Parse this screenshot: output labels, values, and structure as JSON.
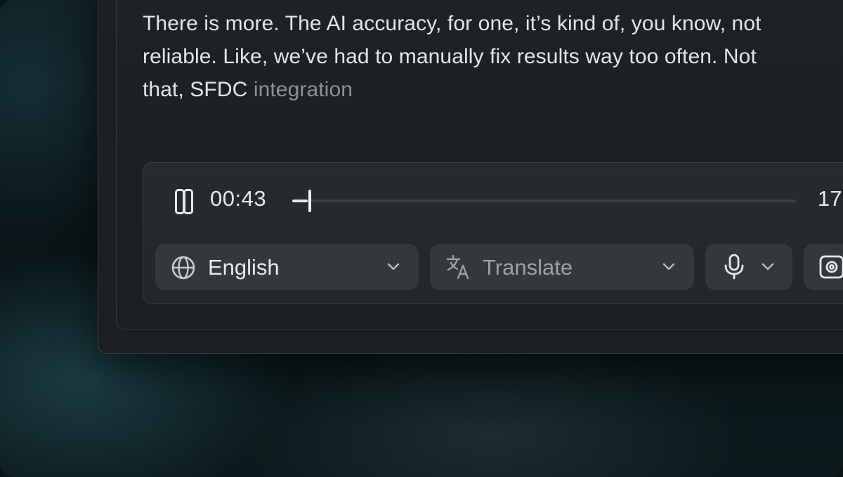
{
  "transcript": {
    "line1": "There is more. The AI accuracy, for one, it’s kind of, you know, not",
    "line2": "reliable. Like, we’ve had to manually fix results way too often. Not",
    "line3_prefix": "that, SFDC ",
    "line3_pending": "integration"
  },
  "player": {
    "current_time": "00:43",
    "duration_partial": "17",
    "progress_fraction": 0.03,
    "pause_icon": "pause-icon"
  },
  "controls": {
    "language": {
      "label": "English",
      "icon": "globe-icon",
      "caret": "chevron-down-icon"
    },
    "translate": {
      "label": "Translate",
      "icon": "translate-icon",
      "caret": "chevron-down-icon"
    },
    "microphone": {
      "icon": "microphone-icon",
      "caret": "chevron-down-icon"
    },
    "camera": {
      "icon": "camera-icon"
    }
  }
}
